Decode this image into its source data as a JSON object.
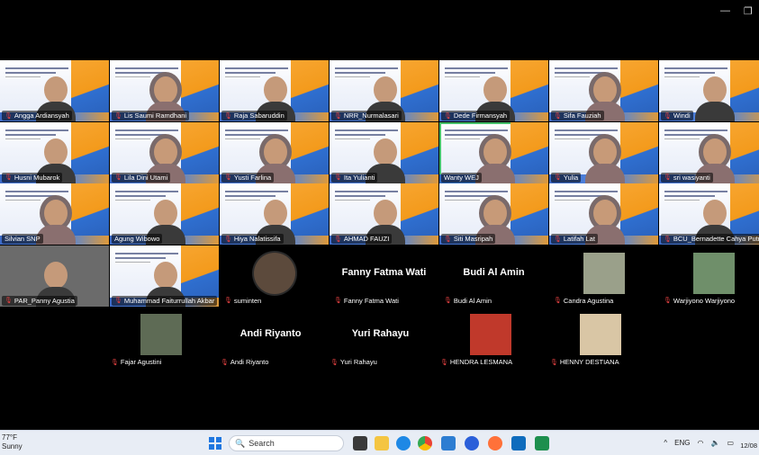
{
  "window": {
    "minimize_glyph": "—",
    "restore_glyph": "❐"
  },
  "grid": {
    "rows": [
      [
        {
          "name": "Angga Ardiansyah",
          "kind": "slide",
          "muted": true
        },
        {
          "name": "Lis Saumi Ramdhani",
          "kind": "slide",
          "muted": true,
          "hijab": true
        },
        {
          "name": "Raja Sabaruddin",
          "kind": "slide",
          "muted": true
        },
        {
          "name": "NRR_Nurmalasari",
          "kind": "slide",
          "muted": true
        },
        {
          "name": "Dede Firmansyah",
          "kind": "slide",
          "muted": true
        },
        {
          "name": "Sifa Fauziah",
          "kind": "slide",
          "muted": true,
          "hijab": true
        },
        {
          "name": "Windi",
          "kind": "slide",
          "muted": true
        }
      ],
      [
        {
          "name": "Husni Mubarok",
          "kind": "slide",
          "muted": true
        },
        {
          "name": "Lila Dini Utami",
          "kind": "slide",
          "muted": true,
          "hijab": true
        },
        {
          "name": "Yusti Farlina",
          "kind": "slide",
          "muted": true,
          "hijab": true
        },
        {
          "name": "Ita Yulianti",
          "kind": "slide",
          "muted": true
        },
        {
          "name": "Wanty WEJ",
          "kind": "slide",
          "muted": false,
          "hijab": true,
          "active": true
        },
        {
          "name": "Yulia",
          "kind": "slide",
          "muted": true,
          "hijab": true
        },
        {
          "name": "sri wasiyanti",
          "kind": "slide",
          "muted": true,
          "hijab": true
        }
      ],
      [
        {
          "name": "Silvian SNP",
          "kind": "slide",
          "muted": false,
          "hijab": true
        },
        {
          "name": "Agung Wibowo",
          "kind": "slide",
          "muted": false
        },
        {
          "name": "Hiya Nalatissifa",
          "kind": "slide",
          "muted": true
        },
        {
          "name": "AHMAD FAUZI",
          "kind": "slide",
          "muted": true
        },
        {
          "name": "Siti Masripah",
          "kind": "slide",
          "muted": true,
          "hijab": true
        },
        {
          "name": "Latifah Lat",
          "kind": "slide",
          "muted": true,
          "hijab": true
        },
        {
          "name": "BCU_Bernadette Cahya Putri Ut",
          "kind": "slide",
          "muted": true
        }
      ],
      [
        {
          "name": "PAR_Panny Agustia",
          "kind": "camera",
          "muted": true
        },
        {
          "name": "Muhammad Faiturrullah Akbar",
          "kind": "slide",
          "muted": true
        },
        {
          "name": "suminten",
          "kind": "avatar",
          "muted": true
        },
        {
          "name": "Fanny Fatma Wati",
          "kind": "plain",
          "muted": true
        },
        {
          "name": "Budi Al Amin",
          "kind": "plain",
          "muted": true
        },
        {
          "name": "Candra Agustina",
          "kind": "avatar",
          "muted": true
        },
        {
          "name": "Warjiyono Warjiyono",
          "kind": "avatar",
          "muted": true
        }
      ],
      [
        {
          "name": "Fajar Agustini",
          "kind": "avatar",
          "muted": true
        },
        {
          "name": "Andi Riyanto",
          "kind": "plain",
          "muted": true
        },
        {
          "name": "Yuri Rahayu",
          "kind": "plain",
          "muted": true
        },
        {
          "name": "HENDRA LESMANA",
          "kind": "avatar",
          "muted": true
        },
        {
          "name": "HENNY DESTIANA",
          "kind": "avatar",
          "muted": true
        }
      ]
    ]
  },
  "taskbar": {
    "temperature": "77°F",
    "weather": "Sunny",
    "search_label": "Search",
    "tray_caret": "^",
    "language": "ENG",
    "clock": "12/08"
  },
  "colors": {
    "accent": "#45c06a",
    "mute": "#e04040"
  }
}
